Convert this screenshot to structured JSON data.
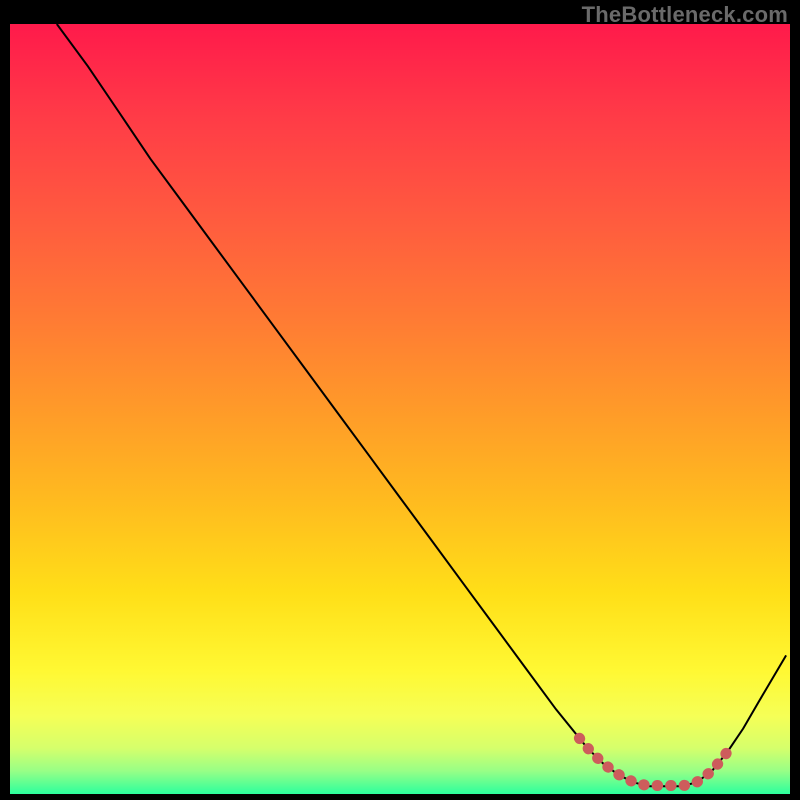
{
  "watermark": "TheBottleneck.com",
  "chart_data": {
    "type": "line",
    "title": "",
    "xlabel": "",
    "ylabel": "",
    "xlim": [
      0,
      100
    ],
    "ylim": [
      0,
      100
    ],
    "grid": false,
    "legend": false,
    "series": [
      {
        "name": "bottleneck-curve",
        "stroke": "#000000",
        "x": [
          6,
          10,
          14,
          18,
          22,
          26,
          30,
          34,
          38,
          42,
          46,
          50,
          54,
          58,
          62,
          66,
          70,
          74,
          76,
          78,
          80,
          82,
          84,
          86,
          88,
          90,
          92,
          94,
          96,
          99.5
        ],
        "values": [
          100,
          94.5,
          88.5,
          82.5,
          77,
          71.5,
          66,
          60.5,
          55,
          49.5,
          44,
          38.5,
          33,
          27.5,
          22,
          16.5,
          11,
          6,
          4,
          2.5,
          1.5,
          1,
          1,
          1,
          1.5,
          3,
          5.5,
          8.5,
          12,
          18
        ]
      }
    ],
    "optimal_band": {
      "name": "optimal-range-marker",
      "color": "#cd5c5c",
      "x_start": 73,
      "x_end": 92,
      "y_at": 1.1
    },
    "gradient_stops": [
      {
        "offset": 0.0,
        "color": "#ff1a4b"
      },
      {
        "offset": 0.12,
        "color": "#ff3b47"
      },
      {
        "offset": 0.25,
        "color": "#ff5a3f"
      },
      {
        "offset": 0.38,
        "color": "#ff7a34"
      },
      {
        "offset": 0.5,
        "color": "#ff9a29"
      },
      {
        "offset": 0.62,
        "color": "#ffbb1f"
      },
      {
        "offset": 0.74,
        "color": "#ffdf18"
      },
      {
        "offset": 0.84,
        "color": "#fff833"
      },
      {
        "offset": 0.9,
        "color": "#f5ff57"
      },
      {
        "offset": 0.94,
        "color": "#d6ff6b"
      },
      {
        "offset": 0.97,
        "color": "#98ff86"
      },
      {
        "offset": 1.0,
        "color": "#2cff9e"
      }
    ]
  }
}
